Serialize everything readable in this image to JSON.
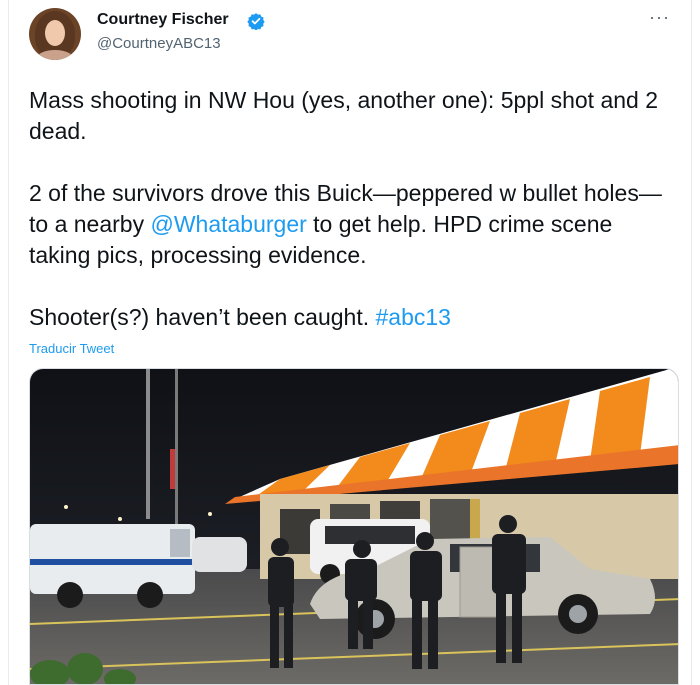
{
  "author": {
    "name": "Courtney Fischer",
    "handle": "@CourtneyABC13",
    "verified": true,
    "avatar_icon": "profile-photo"
  },
  "more_icon": "more-options-icon",
  "tweet": {
    "paragraph1": "Mass shooting in NW Hou (yes, another one): 5ppl shot and 2 dead.",
    "paragraph2_part1": "2 of the survivors drove this Buick—peppered w bullet holes—to a nearby ",
    "paragraph2_mention": "@Whataburger",
    "paragraph2_part2": " to get help. HPD crime scene taking pics, processing evidence.",
    "paragraph3_part1": "Shooter(s?) haven’t been caught. ",
    "paragraph3_hashtag": "#abc13"
  },
  "translate_label": "Traducir Tweet",
  "colors": {
    "link": "#1d9bf0",
    "verified_badge": "#1d9bf0",
    "restaurant_orange": "#f28a1c",
    "night_sky": "#14161c"
  }
}
